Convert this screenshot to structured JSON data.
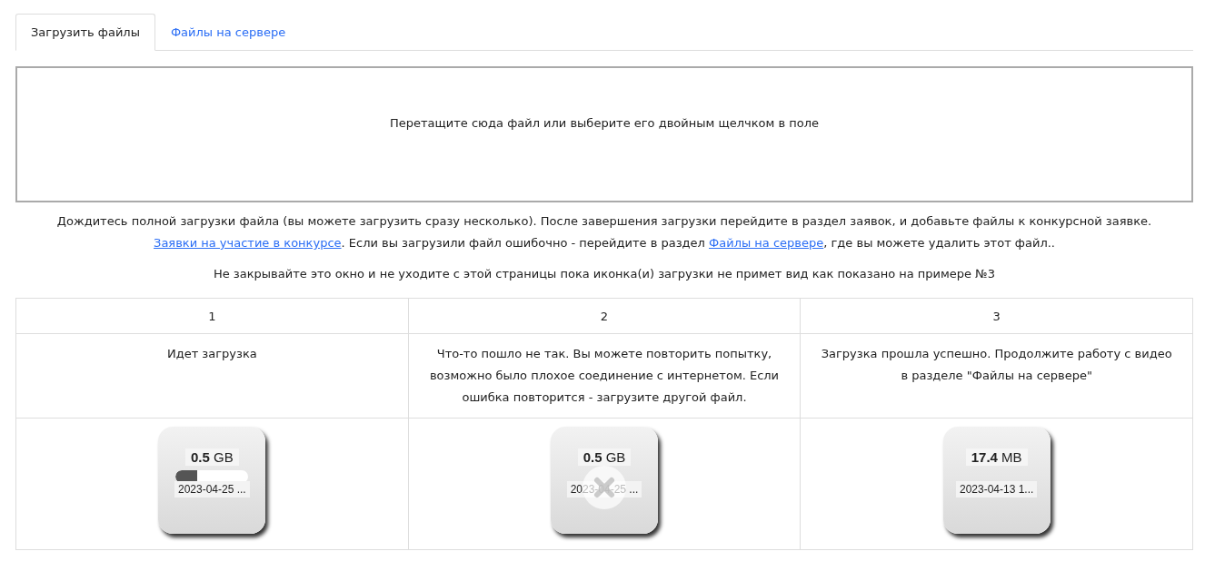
{
  "tabs": [
    {
      "label": "Загрузить файлы",
      "selected": true
    },
    {
      "label": "Файлы на сервере",
      "selected": false
    }
  ],
  "dropzone": {
    "text": "Перетащите сюда файл или выберите его двойным щелчком в поле"
  },
  "info": [
    {
      "kind": "text",
      "text": "Дождитесь полной загрузки файла (вы можете загрузить сразу несколько). После завершения загрузки перейдите в раздел заявок, и добавьте файлы к конкурсной заявке. "
    },
    {
      "kind": "link",
      "text": "Заявки на участие в конкурсе"
    },
    {
      "kind": "text",
      "text": ". Если вы загрузили файл ошибочно - перейдите в раздел "
    },
    {
      "kind": "link",
      "text": "Файлы на сервере"
    },
    {
      "kind": "text",
      "text": ", где вы можете удалить этот файл.."
    }
  ],
  "warning": "Не закрывайте это окно и не уходите с этой страницы пока иконка(и) загрузки не примет вид как показано на примере №3",
  "examples": [
    {
      "number": "1",
      "description": "Идет загрузка",
      "kind": "uploading",
      "size": "**0.5** GB",
      "date": "2023-04-25 ...",
      "level": 0.3
    },
    {
      "number": "2",
      "description": "Что-то пошло не так. Вы можете повторить попытку, возможно было плохое соединение с интернетом. Если ошибка повторится - загрузите другой файл.",
      "kind": "error",
      "size": "**0.5** GB",
      "date": "2023-04-25 ..."
    },
    {
      "number": "3",
      "description": "Загрузка прошла успешно. Продолжите работу с видео в разделе \"Файлы на сервере\"",
      "kind": "done",
      "size": "**17.4** MB",
      "date": "2023-04-13 1..."
    }
  ]
}
